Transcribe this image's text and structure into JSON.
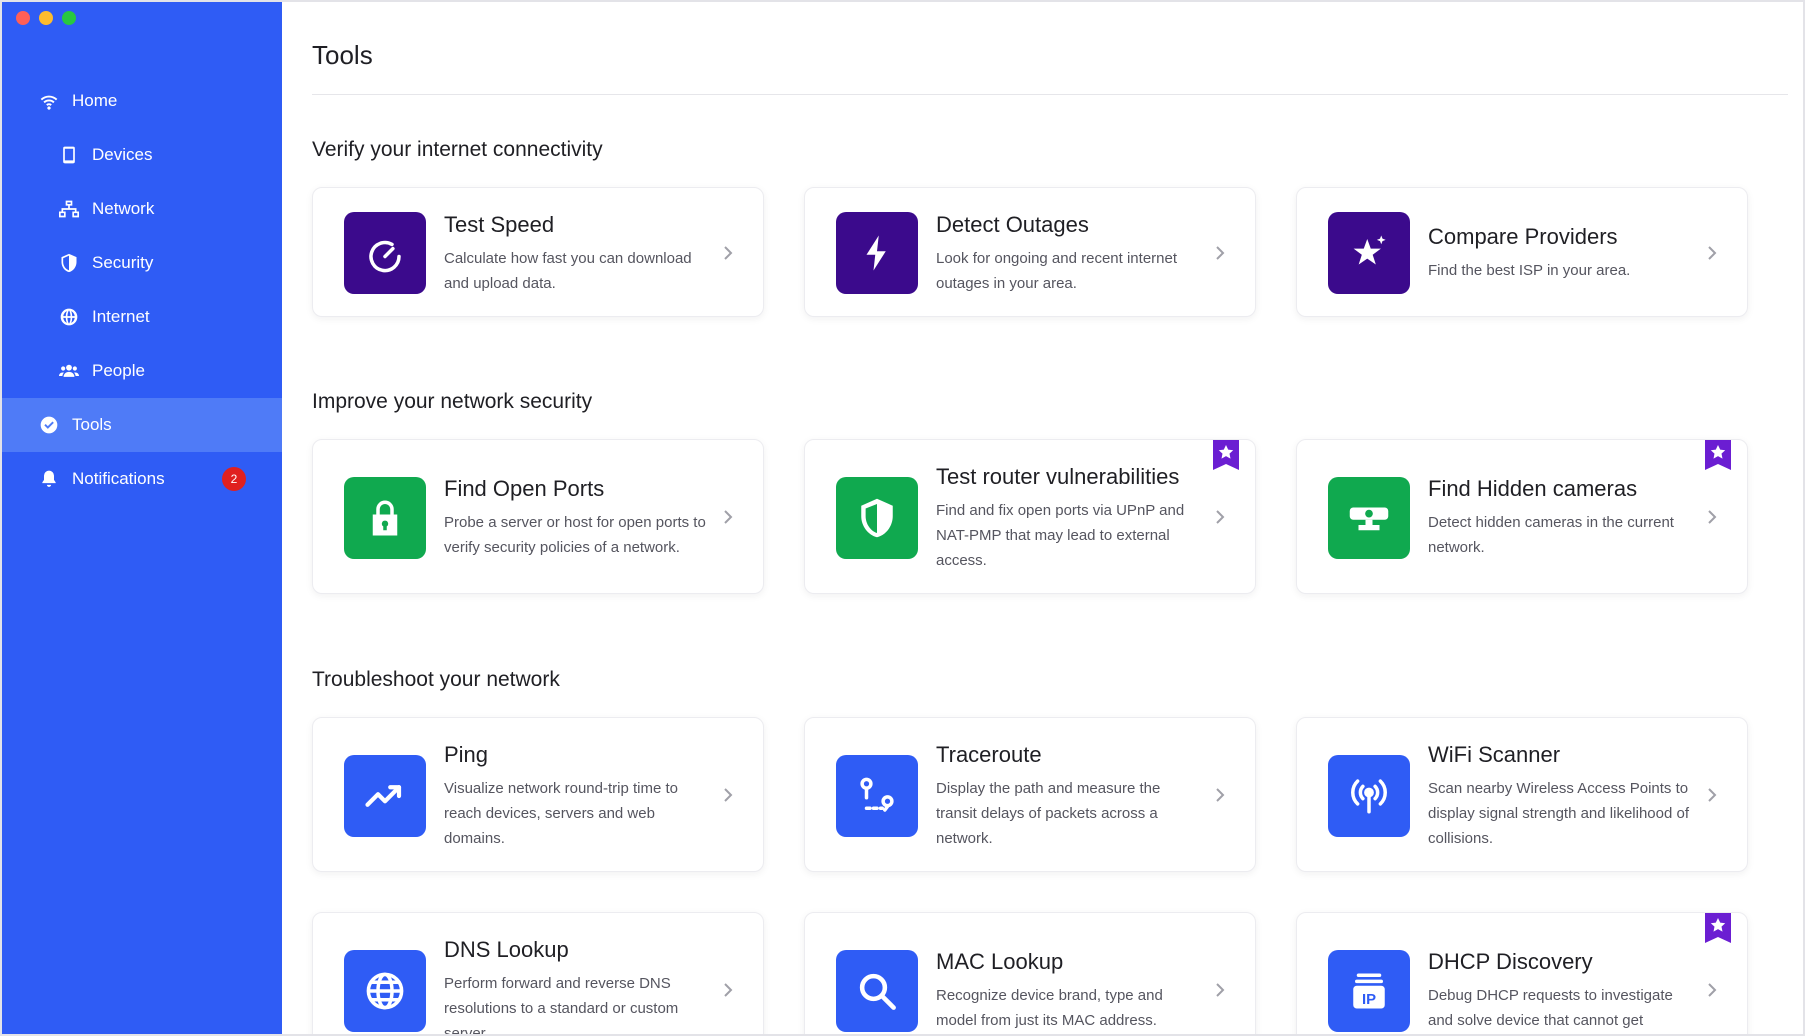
{
  "window": {
    "controls": [
      "close",
      "minimize",
      "zoom"
    ]
  },
  "sidebar": {
    "items": [
      {
        "label": "Home",
        "icon": "wifi-icon"
      },
      {
        "label": "Devices",
        "icon": "phone-icon"
      },
      {
        "label": "Network",
        "icon": "network-icon"
      },
      {
        "label": "Security",
        "icon": "shield-icon"
      },
      {
        "label": "Internet",
        "icon": "globe-icon"
      },
      {
        "label": "People",
        "icon": "people-icon"
      },
      {
        "label": "Tools",
        "icon": "check-circle-icon",
        "active": true
      },
      {
        "label": "Notifications",
        "icon": "bell-icon",
        "badge": "2"
      }
    ]
  },
  "page": {
    "title": "Tools"
  },
  "sections": [
    {
      "title": "Verify your internet connectivity",
      "cards": [
        {
          "title": "Test Speed",
          "desc": "Calculate how fast you can download and upload data.",
          "icon": "speedometer-icon",
          "color": "#3b0a8c"
        },
        {
          "title": "Detect Outages",
          "desc": "Look for ongoing and recent internet outages in your area.",
          "icon": "lightning-icon",
          "color": "#3b0a8c"
        },
        {
          "title": "Compare Providers",
          "desc": "Find the best ISP in your area.",
          "icon": "star-sparkle-icon",
          "color": "#3b0a8c"
        }
      ]
    },
    {
      "title": "Improve your network security",
      "cards": [
        {
          "title": "Find Open Ports",
          "desc": "Probe a server or host for open ports to verify security policies of a network.",
          "icon": "lock-icon",
          "color": "#10a94f"
        },
        {
          "title": "Test router vulnerabilities",
          "desc": "Find and fix open ports via UPnP and NAT-PMP that may lead to external access.",
          "icon": "shield-half-icon",
          "color": "#10a94f",
          "premium": true
        },
        {
          "title": "Find Hidden cameras",
          "desc": "Detect hidden cameras in the current network.",
          "icon": "camera-icon",
          "color": "#10a94f",
          "premium": true
        }
      ]
    },
    {
      "title": "Troubleshoot your network",
      "cards": [
        {
          "title": "Ping",
          "desc": "Visualize network round-trip time to reach devices, servers and web domains.",
          "icon": "trend-up-icon",
          "color": "#2f5cf5"
        },
        {
          "title": "Traceroute",
          "desc": "Display the path and measure the transit delays of packets across a network.",
          "icon": "route-pin-icon",
          "color": "#2f5cf5"
        },
        {
          "title": "WiFi Scanner",
          "desc": "Scan nearby Wireless Access Points to display signal strength and likelihood of collisions.",
          "icon": "antenna-icon",
          "color": "#2f5cf5"
        },
        {
          "title": "DNS Lookup",
          "desc": "Perform forward and reverse DNS resolutions to a standard or custom server.",
          "icon": "globe-icon",
          "color": "#2f5cf5"
        },
        {
          "title": "MAC Lookup",
          "desc": "Recognize device brand, type and model from just its MAC address.",
          "icon": "search-icon",
          "color": "#2f5cf5"
        },
        {
          "title": "DHCP Discovery",
          "desc": "Debug DHCP requests to investigate and solve device that cannot get online.",
          "icon": "ip-icon",
          "color": "#2f5cf5",
          "premium": true,
          "icon_text": "IP"
        }
      ]
    }
  ]
}
